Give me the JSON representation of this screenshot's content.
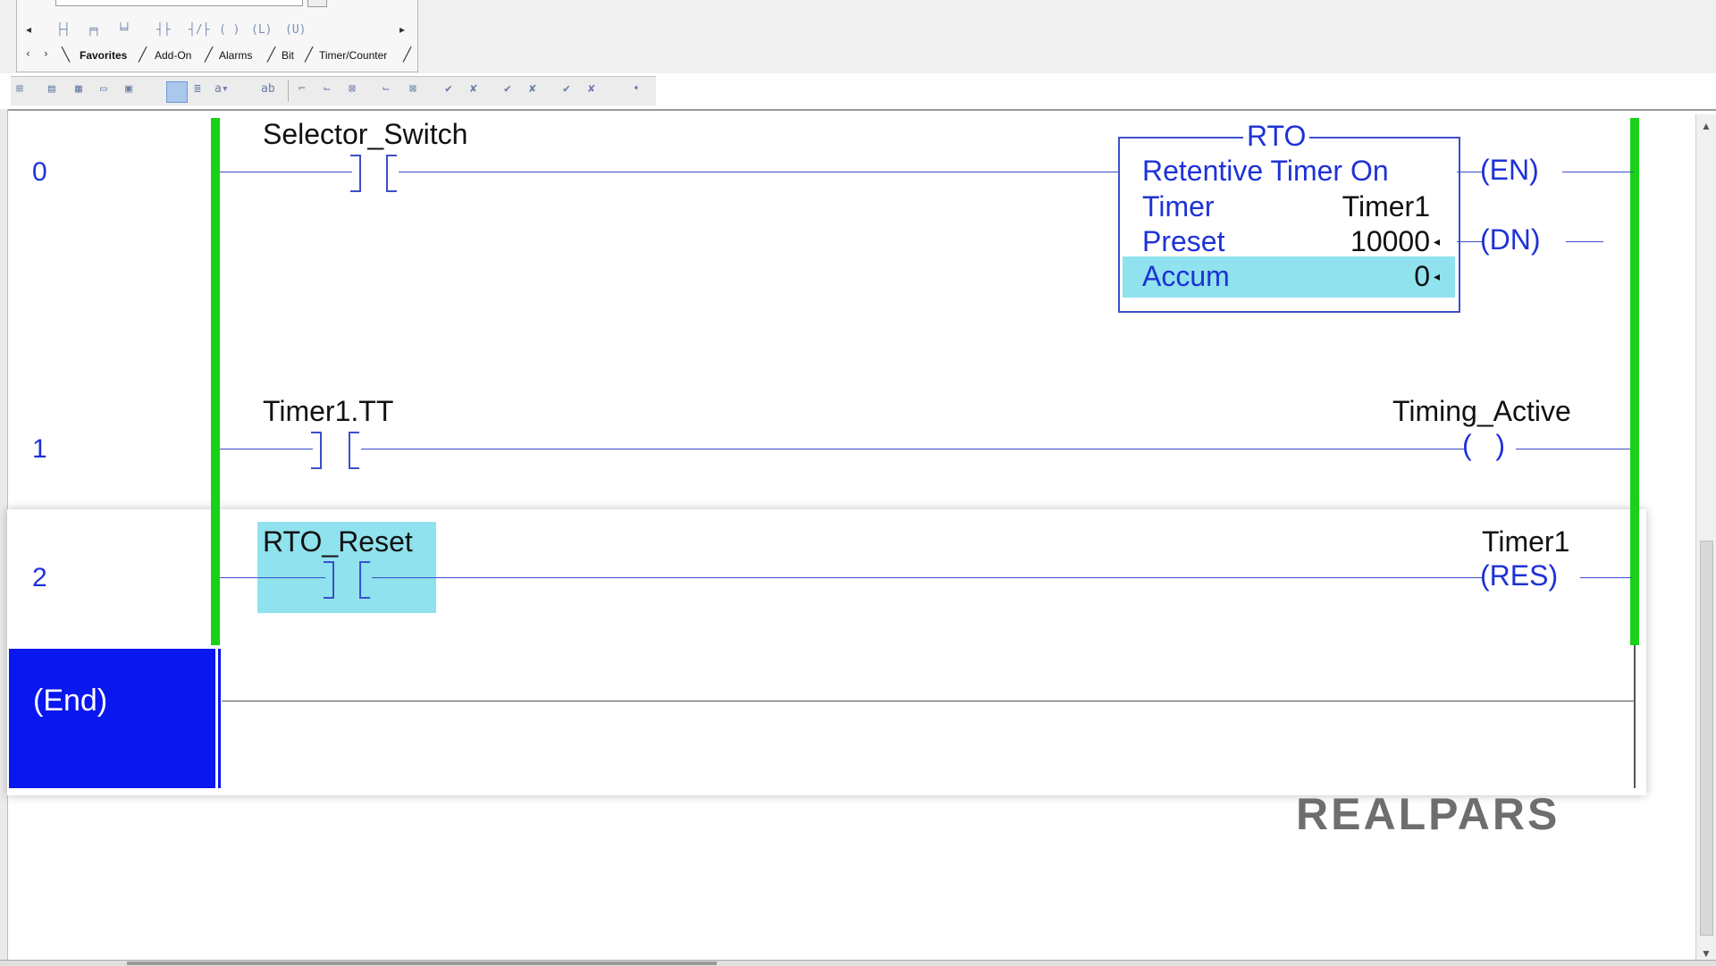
{
  "toolbar": {
    "tabs": [
      "Favorites",
      "Add-On",
      "Alarms",
      "Bit",
      "Timer/Counter"
    ],
    "icons": [
      "rung-icon",
      "branch-icon",
      "branch-level-icon",
      "xic-icon",
      "xio-icon",
      "ote-icon",
      "otl-icon",
      "otu-icon"
    ]
  },
  "rungs": [
    {
      "number": "0",
      "contact_tag": "Selector_Switch",
      "instruction": {
        "mnemonic": "RTO",
        "description": "Retentive Timer On",
        "params": [
          {
            "label": "Timer",
            "value": "Timer1"
          },
          {
            "label": "Preset",
            "value": "10000"
          },
          {
            "label": "Accum",
            "value": "0"
          }
        ],
        "outputs": [
          "EN",
          "DN"
        ]
      }
    },
    {
      "number": "1",
      "contact_tag": "Timer1.TT",
      "coil_tag": "Timing_Active"
    },
    {
      "number": "2",
      "contact_tag": "RTO_Reset",
      "coil_tag": "Timer1",
      "coil_type": "RES"
    }
  ],
  "end_label": "(End)",
  "watermark": "REALPARS",
  "colors": {
    "rail": "#18d118",
    "wire": "#3b4fc8",
    "selection": "#8fe2ee",
    "end_cell": "#0a17ee"
  }
}
